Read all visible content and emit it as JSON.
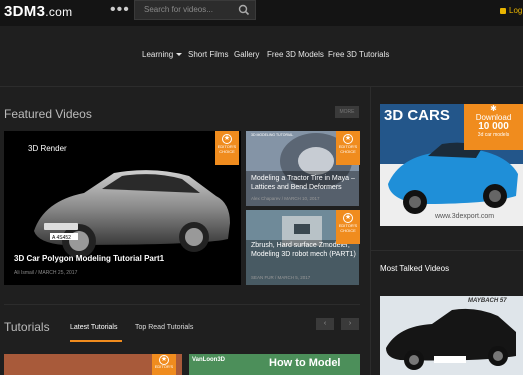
{
  "header": {
    "logo": "3DM3",
    "logo_suffix": ".com",
    "menu_dots": "•••",
    "search_placeholder": "Search for videos...",
    "login_label": "Log"
  },
  "nav": {
    "items": [
      "Learning",
      "Short Films",
      "Gallery",
      "Free 3D Models",
      "Free 3D Tutorials"
    ]
  },
  "featured": {
    "title": "Featured Videos",
    "more_label": "MORE",
    "main": {
      "label": "3D Render",
      "plate": "A 4S452",
      "title": "3D Car Polygon Modeling Tutorial Part1",
      "author": "Ali Ismail",
      "date": "MARCH 25, 2017"
    },
    "side": [
      {
        "title": "Modeling a Tractor Tire in Maya – Lattices and Bend Deformers",
        "author": "Alex Chaparev",
        "date": "MARCH 10, 2017",
        "logo_text": "3D MODELING TUTORIAL"
      },
      {
        "title": "Zbrush, Hard surface Zmodeler, Modeling 3D robot mech (PART1)",
        "author": "SEAN FUR",
        "date": "MARCH 5, 2017"
      }
    ],
    "badge_line1": "EDITOR'S",
    "badge_line2": "CHOICE"
  },
  "ad": {
    "title": "3D CARS",
    "download_line1": "Download",
    "download_line2": "10 000",
    "download_line3": "3d car models",
    "url": "www.3dexport.com"
  },
  "sidebar": {
    "most_talked": "Most Talked Videos",
    "car_plate_text": "MAYBACH 57"
  },
  "tutorials": {
    "title": "Tutorials",
    "tabs": [
      "Latest Tutorials",
      "Top Read Tutorials"
    ],
    "prev": "‹",
    "next": "›",
    "thumb_text": "How to Model",
    "thumb_brand": "VanLoon3D"
  }
}
